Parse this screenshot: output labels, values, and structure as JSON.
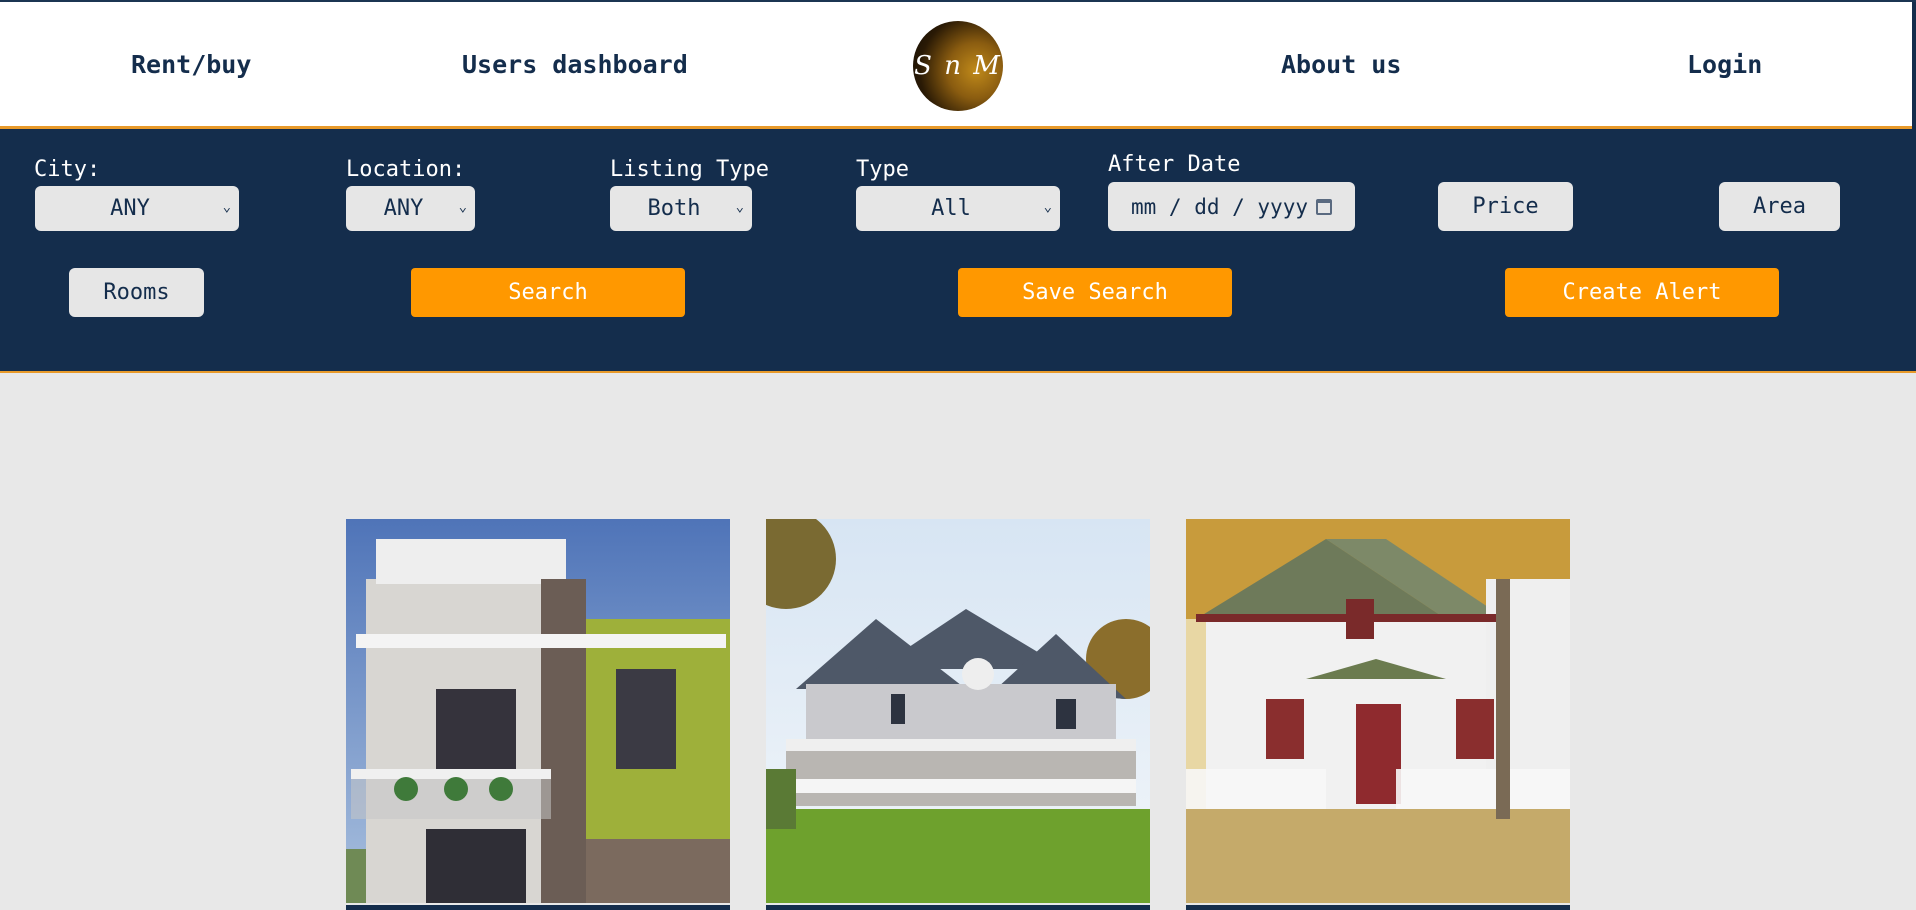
{
  "nav": {
    "rent_buy": "Rent/buy",
    "users_dashboard": "Users dashboard",
    "logo_text": "S n M",
    "about_us": "About us",
    "login": "Login"
  },
  "filters": {
    "city": {
      "label": "City:",
      "value": "ANY"
    },
    "location": {
      "label": "Location:",
      "value": "ANY"
    },
    "listing_type": {
      "label": "Listing Type",
      "value": "Both"
    },
    "type": {
      "label": "Type",
      "value": "All"
    },
    "after_date": {
      "label": "After Date",
      "placeholder": "mm / dd / yyyy"
    },
    "price_button": "Price",
    "area_button": "Area",
    "rooms_button": "Rooms",
    "search_button": "Search",
    "save_search_button": "Save Search",
    "create_alert_button": "Create Alert"
  },
  "listings": [
    {
      "photo": "modern-two-story-house"
    },
    {
      "photo": "white-farmhouse-with-porch"
    },
    {
      "photo": "white-cottage-with-picket-fence"
    }
  ],
  "colors": {
    "navy": "#142d4c",
    "orange": "#ff9800",
    "accent_line": "#e89a2a",
    "page_bg": "#e8e8e8"
  }
}
